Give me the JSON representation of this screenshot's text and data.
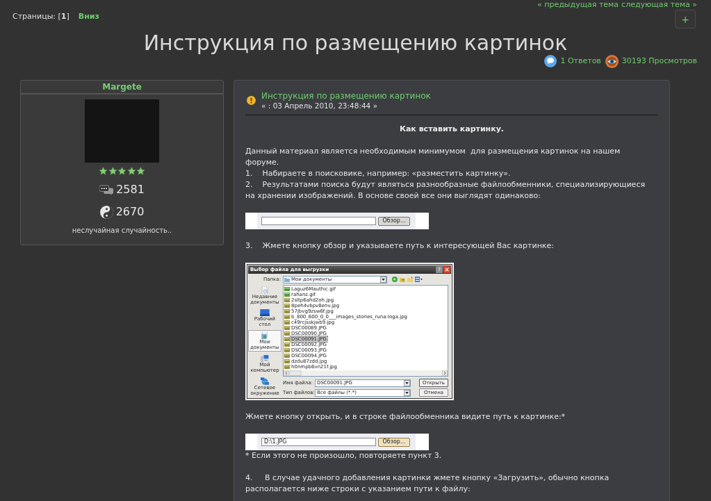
{
  "topic_nav": {
    "links": [
      "« предыдущая тема",
      "следующая тема »"
    ]
  },
  "pagination": {
    "text": "Страницы: [**1**]",
    "jump_link": "Вниз"
  },
  "add_button": {
    "label": "+"
  },
  "title": "Инструкция по размещению картинок",
  "topic_stats": [
    {
      "kind": "replies",
      "text": "1 Ответов"
    },
    {
      "kind": "views",
      "text": "30193 Просмотров"
    }
  ],
  "author": {
    "name": "Margete",
    "stars": 5,
    "stats": [
      {
        "kind": "posts",
        "value": "2581"
      },
      {
        "kind": "karma",
        "value": "2670"
      }
    ],
    "signature": "неслучайная случайность.."
  },
  "post": {
    "title": "Инструкция по размещению картинок",
    "date": "« : 03 Апрель 2010, 23:48:44 »",
    "body": [
      [
        {
          "kind": "heading",
          "text": "Как вставить картинку."
        }
      ],
      [
        {
          "kind": "paragraph",
          "text": "Данный материал является необходимым минимумом  для размещения картинок на нашем форуме."
        },
        {
          "kind": "paragraph",
          "text": "1.    Набираете в поисковике, например: «разместить картинку»."
        },
        {
          "kind": "paragraph",
          "text": "2.    Результатами поиска будут являться разнообразные файлообменники, специализирующиеся на хранении изображений. В основе своей все они выглядят одинаково:"
        }
      ],
      [
        {
          "kind": "upload_field",
          "button": "Обзор...",
          "button_highlighted": false
        }
      ],
      [
        {
          "kind": "paragraph",
          "text": "3.    Жмете кнопку обзор и указываете путь к интересующей Вас картинке:"
        }
      ],
      [
        {
          "kind": "file_dialog",
          "title": "Выбор файла для выгрузки",
          "help_button": "?",
          "folder_label": "Папка:",
          "folder": "Мои документы",
          "places": [
            {
              "kind": "recent",
              "label": "Недавние документы",
              "selected": false
            },
            {
              "kind": "desktop",
              "label": "Рабочий стол",
              "selected": false
            },
            {
              "kind": "documents",
              "label": "Мои документы",
              "selected": true
            },
            {
              "kind": "computer",
              "label": "Мой компьютер",
              "selected": false
            },
            {
              "kind": "network",
              "label": "Сетевое окружение",
              "selected": false
            }
          ],
          "files": [
            {
              "kind": "gif",
              "name": "Laguz6Mauthic.gif",
              "selected": false
            },
            {
              "kind": "gif",
              "name": "rahanz.gif",
              "selected": false
            },
            {
              "kind": "jpg",
              "name": "2sltp6ahd2oh.jpg",
              "selected": false
            },
            {
              "kind": "jpg",
              "name": "8peh4vbpv8env.jpg",
              "selected": false
            },
            {
              "kind": "jpg",
              "name": "57jbvg9zsw6f.jpg",
              "selected": false
            },
            {
              "kind": "jpg",
              "name": "b_800_600_0_0___images_stories_runa-loga.jpg",
              "selected": false
            },
            {
              "kind": "jpg",
              "name": "c49rcjsskjwb9.jpg",
              "selected": false
            },
            {
              "kind": "jpg",
              "name": "DSC00089.JPG",
              "selected": false
            },
            {
              "kind": "jpg",
              "name": "DSC00090.JPG",
              "selected": false
            },
            {
              "kind": "jpg",
              "name": "DSC00091.JPG",
              "selected": true
            },
            {
              "kind": "jpg",
              "name": "DSC00092.JPG",
              "selected": false
            },
            {
              "kind": "jpg",
              "name": "DSC00093.JPG",
              "selected": false
            },
            {
              "kind": "jpg",
              "name": "DSC00094.JPG",
              "selected": false
            },
            {
              "kind": "jpg",
              "name": "dzdu87zdd.jpg",
              "selected": false
            },
            {
              "kind": "jpg",
              "name": "h0nmpb6vn21f.jpg",
              "selected": false
            }
          ],
          "filename_label": "Имя файла:",
          "filename": "DSC00091.JPG",
          "filetype_label": "Тип файлов:",
          "filetype": "Все файлы (*.*)",
          "buttons": [
            "Открыть",
            "Отмена"
          ]
        }
      ],
      [
        {
          "kind": "paragraph",
          "text": "Жмете кнопку открыть, и в строке файлообменника видите путь к картинке:*"
        }
      ],
      [
        {
          "kind": "upload_field",
          "value": "D:\\1.JPG",
          "button": "Обзор...",
          "button_highlighted": true
        },
        {
          "kind": "paragraph",
          "text": "* Если этого не произошло, повторяете пункт 3."
        }
      ],
      [
        {
          "kind": "paragraph",
          "text": "4.     В случае удачного добавления картинки жмете кнопку «Загрузить», обычно кнопка располагается ниже строки с указанием пути к файлу:"
        }
      ]
    ]
  }
}
